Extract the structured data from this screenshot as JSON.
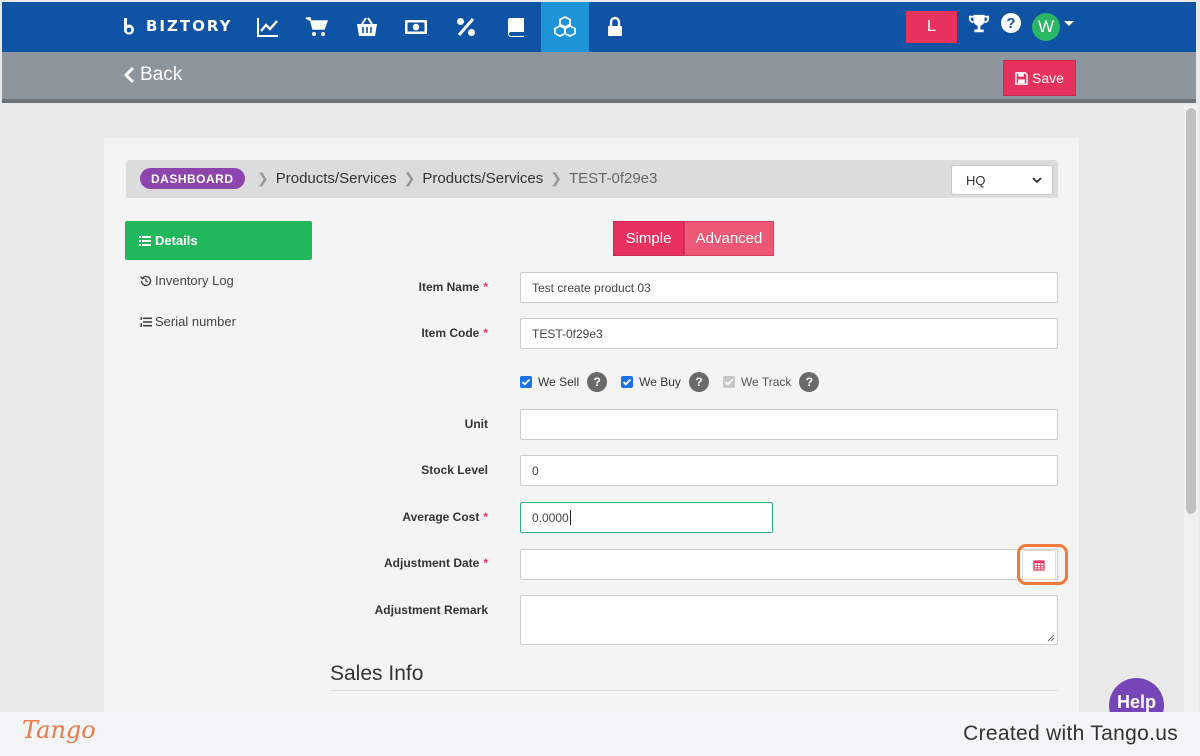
{
  "nav": {
    "brand": "BIZTORY",
    "icons": [
      "chart-line-icon",
      "cart-icon",
      "basket-icon",
      "money-icon",
      "percent-icon",
      "book-icon",
      "cubes-icon",
      "lock-icon"
    ],
    "active_icon": "cubes-icon",
    "user_initial_box": "L",
    "avatar_initial": "W",
    "help_glyph": "?",
    "colors": {
      "nav_bg": "#0f53a5",
      "active": "#1d95d8",
      "accent": "#e6325c",
      "avatar": "#29b765"
    }
  },
  "subbar": {
    "back_label": "Back",
    "save_label": "Save"
  },
  "breadcrumb": {
    "badge": "DASHBOARD",
    "items": [
      "Products/Services",
      "Products/Services",
      "TEST-0f29e3"
    ],
    "branch_selected": "HQ"
  },
  "sidebar": {
    "details": "Details",
    "inventory_log": "Inventory Log",
    "serial_number": "Serial number"
  },
  "mode_toggle": {
    "simple": "Simple",
    "advanced": "Advanced",
    "selected": "Simple"
  },
  "form": {
    "item_name": {
      "label": "Item Name",
      "required": "*",
      "value": "Test create product 03"
    },
    "item_code": {
      "label": "Item Code",
      "required": "*",
      "value": "TEST-0f29e3"
    },
    "checkboxes": {
      "we_sell": {
        "label": "We Sell",
        "checked": true
      },
      "we_buy": {
        "label": "We Buy",
        "checked": true
      },
      "we_track": {
        "label": "We Track",
        "checked": true,
        "disabled": true
      },
      "help": "?"
    },
    "unit": {
      "label": "Unit",
      "value": ""
    },
    "stock_level": {
      "label": "Stock Level",
      "value": "0"
    },
    "average_cost": {
      "label": "Average Cost",
      "required": "*",
      "value": "0.0000"
    },
    "adjustment_date": {
      "label": "Adjustment Date",
      "required": "*",
      "value": ""
    },
    "adjustment_remark": {
      "label": "Adjustment Remark",
      "value": ""
    }
  },
  "sections": {
    "sales_info": "Sales Info"
  },
  "help_bubble": "Help",
  "footer": {
    "logo": "Tango",
    "credit": "Created with Tango.us"
  }
}
